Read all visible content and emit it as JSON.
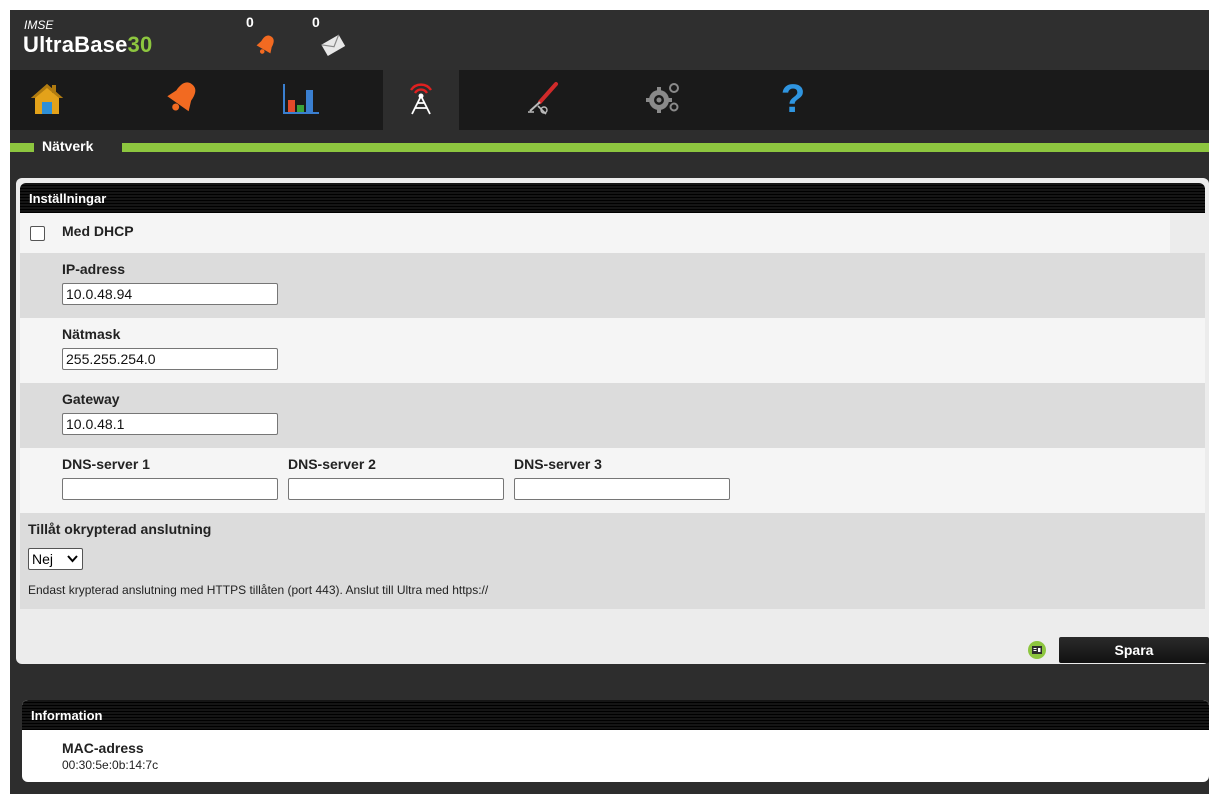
{
  "header": {
    "brand_small": "IMSE",
    "brand_main": "UltraBase",
    "brand_num": "30",
    "alarm_count": "0",
    "message_count": "0"
  },
  "nav": {
    "tabs": [
      {
        "icon": "home-icon"
      },
      {
        "icon": "bell-icon"
      },
      {
        "icon": "chart-icon"
      },
      {
        "icon": "network-tower-icon",
        "active": true
      },
      {
        "icon": "tools-icon"
      },
      {
        "icon": "gears-icon"
      },
      {
        "icon": "help-icon"
      }
    ]
  },
  "section_title": "Nätverk",
  "settings": {
    "title": "Inställningar",
    "dhcp_label": "Med DHCP",
    "ip_label": "IP-adress",
    "ip_value": "10.0.48.94",
    "mask_label": "Nätmask",
    "mask_value": "255.255.254.0",
    "gateway_label": "Gateway",
    "gateway_value": "10.0.48.1",
    "dns1_label": "DNS-server 1",
    "dns2_label": "DNS-server 2",
    "dns3_label": "DNS-server 3",
    "dns1_value": "",
    "dns2_value": "",
    "dns3_value": "",
    "unencrypted_label": "Tillåt okrypterad anslutning",
    "unencrypted_value": "Nej",
    "unencrypted_note": "Endast krypterad anslutning med HTTPS tillåten (port 443). Anslut till Ultra med https://"
  },
  "save_label": "Spara",
  "information": {
    "title": "Information",
    "mac_label": "MAC-adress",
    "mac_value": "00:30:5e:0b:14:7c"
  },
  "colors": {
    "accent": "#8dc63f",
    "header_bg": "#2f2f2f",
    "nav_bg": "#1a1a1a"
  }
}
